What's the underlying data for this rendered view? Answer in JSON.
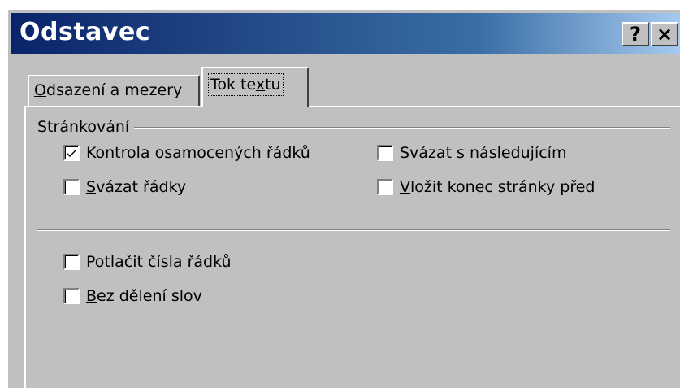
{
  "window": {
    "title": "Odstavec",
    "help_button": "?",
    "close_button": "×"
  },
  "tabs": [
    {
      "label_pre": "",
      "accel": "O",
      "label_post": "dsazení a mezery",
      "active": false
    },
    {
      "label_pre": "Tok te",
      "accel": "x",
      "label_post": "tu",
      "active": true
    }
  ],
  "pagination": {
    "group_label": "Stránkování",
    "options": [
      {
        "pre": "",
        "accel": "K",
        "post": "ontrola osamocených řádků",
        "checked": true
      },
      {
        "pre": "",
        "accel": "S",
        "post": "vázat řádky",
        "checked": false
      },
      {
        "pre": "Svázat s ",
        "accel": "n",
        "post": "ásledujícím",
        "checked": false
      },
      {
        "pre": "",
        "accel": "V",
        "post": "ložit konec stránky před",
        "checked": false
      }
    ]
  },
  "other_options": [
    {
      "pre": "",
      "accel": "P",
      "post": "otlačit čísla řádků",
      "checked": false
    },
    {
      "pre": "",
      "accel": "B",
      "post": "ez dělení slov",
      "checked": false
    }
  ],
  "colors": {
    "dialog_face": "#c0c0c0",
    "titlebar_start": "#0a246a",
    "titlebar_end": "#a6caf0",
    "title_text": "#ffffff"
  }
}
